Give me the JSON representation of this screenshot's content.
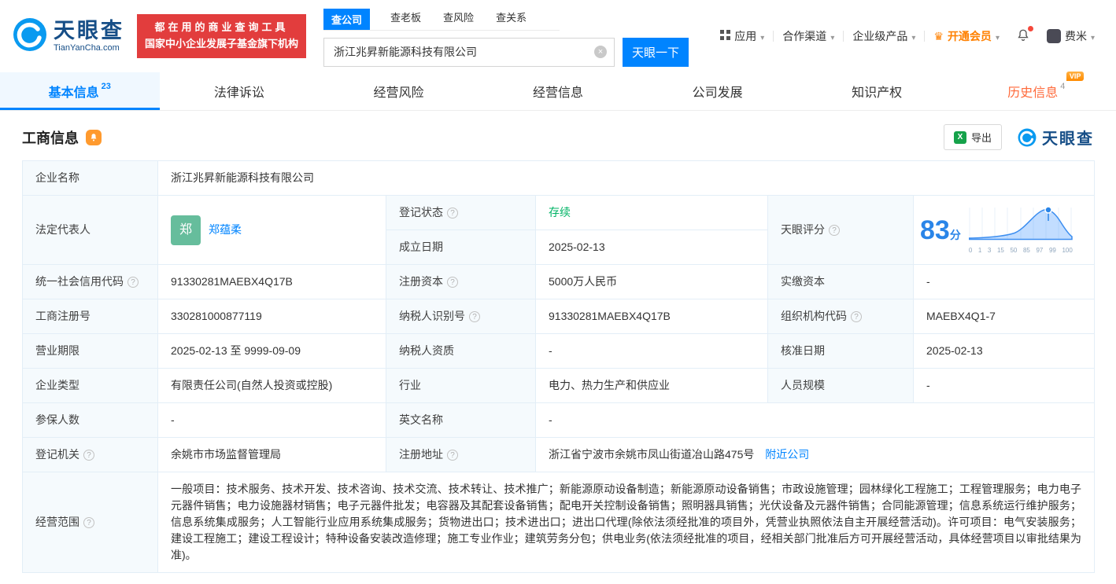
{
  "colors": {
    "brand_blue": "#0084ff",
    "banner_red": "#e23d3d",
    "status_green": "#00b365",
    "history_orange": "#ff6a3b",
    "vip_gold": "#ff8a00",
    "logo_navy": "#164e87",
    "avatar_green": "#66bd9c"
  },
  "header": {
    "logo": {
      "name": "天眼查",
      "domain": "TianYanCha.com"
    },
    "banner": {
      "line1": "都在用的商业查询工具",
      "line2": "国家中小企业发展子基金旗下机构"
    },
    "search": {
      "tabs": [
        {
          "label": "查公司"
        },
        {
          "label": "查老板"
        },
        {
          "label": "查风险"
        },
        {
          "label": "查关系"
        }
      ],
      "value": "浙江兆昇新能源科技有限公司",
      "button_label": "天眼一下"
    },
    "menu": {
      "apps": "应用",
      "partners": "合作渠道",
      "enterprise": "企业级产品",
      "vip": "开通会员",
      "user": "费米"
    }
  },
  "nav": {
    "tabs": [
      {
        "label": "基本信息",
        "count": "23"
      },
      {
        "label": "法律诉讼"
      },
      {
        "label": "经营风险"
      },
      {
        "label": "经营信息"
      },
      {
        "label": "公司发展"
      },
      {
        "label": "知识产权"
      },
      {
        "label": "历史信息",
        "count": "4",
        "badge": "VIP"
      }
    ]
  },
  "section": {
    "title": "工商信息",
    "export_label": "导出",
    "brand": "天眼查"
  },
  "info": {
    "company_name": {
      "label": "企业名称",
      "value": "浙江兆昇新能源科技有限公司"
    },
    "legal_rep": {
      "label": "法定代表人",
      "value": "郑蕴柔",
      "avatar": "郑"
    },
    "reg_status": {
      "label": "登记状态",
      "value": "存续"
    },
    "establish_date": {
      "label": "成立日期",
      "value": "2025-02-13"
    },
    "score": {
      "label": "天眼评分"
    },
    "credit_code": {
      "label": "统一社会信用代码",
      "value": "91330281MAEBX4Q17B"
    },
    "reg_capital": {
      "label": "注册资本",
      "value": "5000万人民币"
    },
    "paid_capital": {
      "label": "实缴资本",
      "value": "-"
    },
    "reg_number": {
      "label": "工商注册号",
      "value": "330281000877119"
    },
    "taxpayer_id": {
      "label": "纳税人识别号",
      "value": "91330281MAEBX4Q17B"
    },
    "org_code": {
      "label": "组织机构代码",
      "value": "MAEBX4Q1-7"
    },
    "business_term": {
      "label": "营业期限",
      "value": "2025-02-13 至 9999-09-09"
    },
    "taxpayer_quality": {
      "label": "纳税人资质",
      "value": "-"
    },
    "approval_date": {
      "label": "核准日期",
      "value": "2025-02-13"
    },
    "company_type": {
      "label": "企业类型",
      "value": "有限责任公司(自然人投资或控股)"
    },
    "industry": {
      "label": "行业",
      "value": "电力、热力生产和供应业"
    },
    "staff_size": {
      "label": "人员规模",
      "value": "-"
    },
    "insured_count": {
      "label": "参保人数",
      "value": "-"
    },
    "english_name": {
      "label": "英文名称",
      "value": "-"
    },
    "reg_authority": {
      "label": "登记机关",
      "value": "余姚市市场监督管理局"
    },
    "reg_address": {
      "label": "注册地址",
      "value": "浙江省宁波市余姚市凤山街道冶山路475号",
      "link": "附近公司"
    },
    "business_scope": {
      "label": "经营范围",
      "value": "一般项目：技术服务、技术开发、技术咨询、技术交流、技术转让、技术推广；新能源原动设备制造；新能源原动设备销售；市政设施管理；园林绿化工程施工；工程管理服务；电力电子元器件销售；电力设施器材销售；电子元器件批发；电容器及其配套设备销售；配电开关控制设备销售；照明器具销售；光伏设备及元器件销售；合同能源管理；信息系统运行维护服务；信息系统集成服务；人工智能行业应用系统集成服务；货物进出口；技术进出口；进出口代理(除依法须经批准的项目外，凭营业执照依法自主开展经营活动)。许可项目：电气安装服务；建设工程施工；建设工程设计；特种设备安装改造修理；施工专业作业；建筑劳务分包；供电业务(依法须经批准的项目，经相关部门批准后方可开展经营活动，具体经营项目以审批结果为准)。"
    }
  },
  "score_chart": {
    "type": "area",
    "score": "83",
    "unit": "分",
    "x_ticks": [
      "0",
      "1",
      "3",
      "15",
      "50",
      "85",
      "97",
      "99",
      "100"
    ],
    "marker_at": "85"
  }
}
